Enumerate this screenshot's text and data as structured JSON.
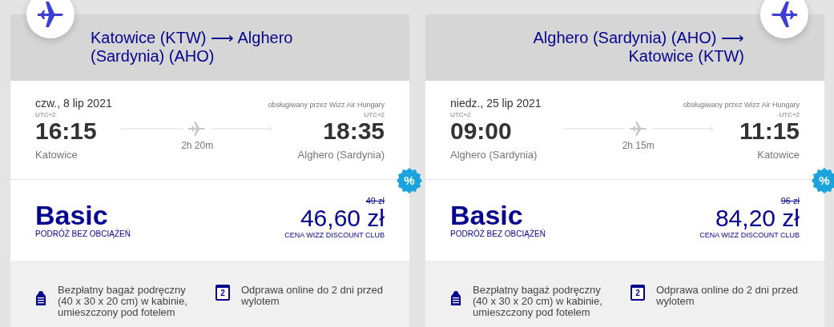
{
  "flights": [
    {
      "route": "Katowice (KTW) ⟶ Alghero (Sardynia) (AHO)",
      "mirrored": false,
      "date": "czw., 8 lip 2021",
      "operator": "obsługiwany przez Wizz Air Hungary",
      "departure": {
        "timezone": "UTC+2",
        "time": "16:15",
        "city": "Katowice"
      },
      "arrival": {
        "timezone": "UTC+2",
        "time": "18:35",
        "city": "Alghero (Sardynia)"
      },
      "duration": "2h 20m",
      "fare": {
        "name": "Basic",
        "tagline": "PODRÓŻ BEZ OBCIĄŻEŃ",
        "old_price": "49 zł",
        "price": "46,60 zł",
        "price_note": "CENA WIZZ DISCOUNT CLUB",
        "badge": "%"
      },
      "features": [
        {
          "kind": "bag",
          "text": "Bezpłatny bagaż podręczny (40 x 30 x 20 cm) w kabinie, umieszczony pod fotelem"
        },
        {
          "kind": "calendar",
          "day": "2",
          "text": "Odprawa online do 2 dni przed wylotem"
        }
      ]
    },
    {
      "route": "Alghero (Sardynia) (AHO) ⟶ Katowice (KTW)",
      "mirrored": true,
      "date": "niedz., 25 lip 2021",
      "operator": "obsługiwany przez Wizz Air Hungary",
      "departure": {
        "timezone": "UTC+2",
        "time": "09:00",
        "city": "Alghero (Sardynia)"
      },
      "arrival": {
        "timezone": "UTC+2",
        "time": "11:15",
        "city": "Katowice"
      },
      "duration": "2h 15m",
      "fare": {
        "name": "Basic",
        "tagline": "PODRÓŻ BEZ OBCIĄŻEŃ",
        "old_price": "96 zł",
        "price": "84,20 zł",
        "price_note": "CENA WIZZ DISCOUNT CLUB",
        "badge": "%"
      },
      "features": [
        {
          "kind": "bag",
          "text": "Bezpłatny bagaż podręczny (40 x 30 x 20 cm) w kabinie, umieszczony pod fotelem"
        },
        {
          "kind": "calendar",
          "day": "2",
          "text": "Odprawa online do 2 dni przed wylotem"
        }
      ]
    }
  ]
}
